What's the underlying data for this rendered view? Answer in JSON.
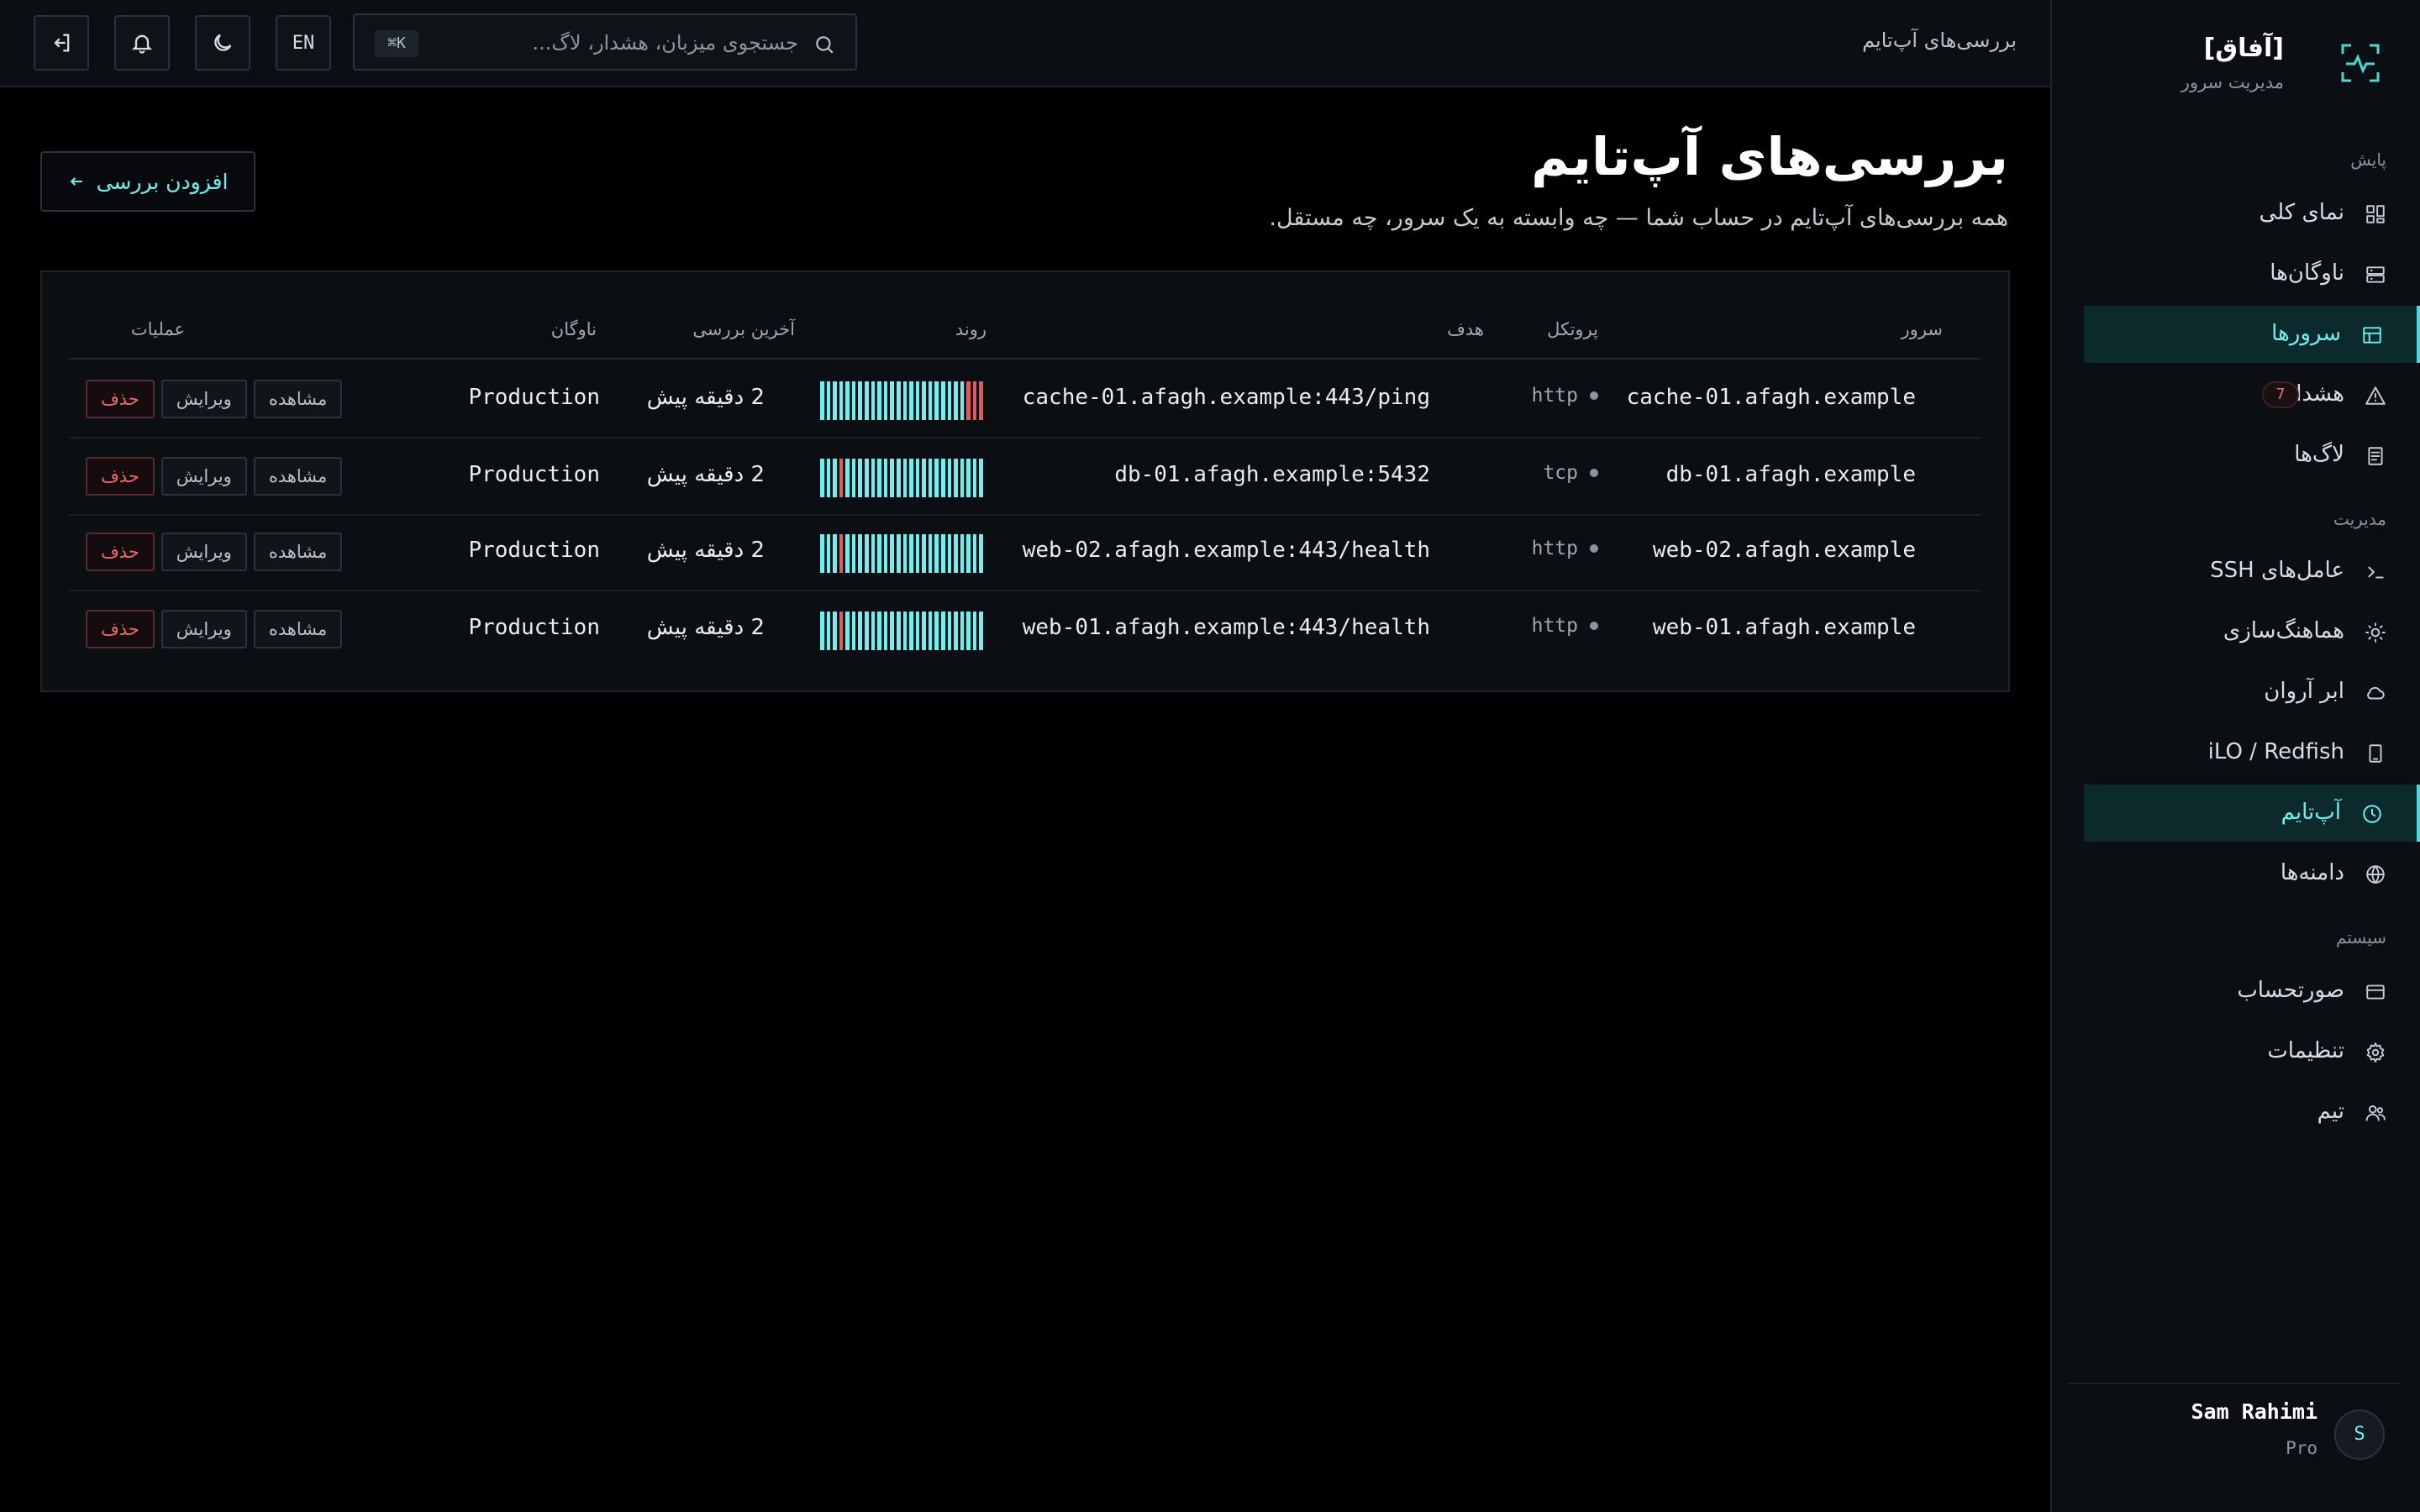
{
  "brand": {
    "name": "[آفاق]",
    "subtitle": "مدیریت سرور"
  },
  "header": {
    "title": "بررسی‌های آپ‌تایم",
    "search_placeholder": "جستجوی میزبان، هشدار، لاگ...",
    "search_shortcut": "⌘K",
    "language": "EN"
  },
  "sidebar": {
    "sections": [
      {
        "label": "پایش",
        "items": [
          {
            "label": "نمای کلی",
            "icon": "grid-icon"
          },
          {
            "label": "ناوگان‌ها",
            "icon": "server-stack-icon"
          },
          {
            "label": "سرورها",
            "icon": "table-icon",
            "active": true
          },
          {
            "label": "هشدارها",
            "icon": "warning-icon",
            "badge": "7"
          },
          {
            "label": "لاگ‌ها",
            "icon": "document-icon"
          }
        ]
      },
      {
        "label": "مدیریت",
        "items": [
          {
            "label": "عامل‌های SSH",
            "icon": "terminal-icon"
          },
          {
            "label": "هماهنگ‌سازی",
            "icon": "sun-icon"
          },
          {
            "label": "ابر آروان",
            "icon": "cloud-icon"
          },
          {
            "label": "iLO / Redfish",
            "icon": "device-icon"
          },
          {
            "label": "آپ‌تایم",
            "icon": "clock-icon",
            "active": true
          },
          {
            "label": "دامنه‌ها",
            "icon": "globe-icon"
          }
        ]
      },
      {
        "label": "سیستم",
        "items": [
          {
            "label": "صورتحساب",
            "icon": "card-icon"
          },
          {
            "label": "تنظیمات",
            "icon": "gear-icon"
          },
          {
            "label": "تیم",
            "icon": "users-icon"
          }
        ]
      }
    ],
    "user": {
      "initial": "S",
      "name": "Sam Rahimi",
      "plan": "Pro"
    }
  },
  "main": {
    "title": "بررسی‌های آپ‌تایم",
    "subtitle": "همه بررسی‌های آپ‌تایم در حساب شما — چه وابسته به یک سرور، چه مستقل.",
    "add_button": "افزودن بررسی",
    "columns": {
      "server": "سرور",
      "protocol": "پروتکل",
      "target": "هدف",
      "trend": "روند",
      "last_check": "آخرین بررسی",
      "fleet": "ناوگان",
      "actions": "عملیات"
    },
    "action_labels": {
      "view": "مشاهده",
      "edit": "ویرایش",
      "delete": "حذف"
    },
    "rows": [
      {
        "server": "cache-01.afagh.example",
        "protocol": "http",
        "target": "cache-01.afagh.example:443/ping",
        "last_check": "2 دقیقه پیش",
        "fleet": "Production",
        "trend": [
          1,
          1,
          1,
          1,
          1,
          1,
          1,
          1,
          1,
          1,
          1,
          1,
          1,
          1,
          1,
          1,
          1,
          1,
          1,
          1,
          1,
          1,
          1,
          0,
          0,
          0
        ]
      },
      {
        "server": "db-01.afagh.example",
        "protocol": "tcp",
        "target": "db-01.afagh.example:5432",
        "last_check": "2 دقیقه پیش",
        "fleet": "Production",
        "trend": [
          1,
          1,
          1,
          0,
          1,
          1,
          1,
          1,
          1,
          1,
          1,
          1,
          1,
          1,
          1,
          1,
          1,
          1,
          1,
          1,
          1,
          1,
          1,
          1,
          1,
          1
        ]
      },
      {
        "server": "web-02.afagh.example",
        "protocol": "http",
        "target": "web-02.afagh.example:443/health",
        "last_check": "2 دقیقه پیش",
        "fleet": "Production",
        "trend": [
          1,
          1,
          1,
          0,
          1,
          1,
          1,
          1,
          1,
          1,
          1,
          1,
          1,
          1,
          1,
          1,
          1,
          1,
          1,
          1,
          1,
          1,
          1,
          1,
          1,
          1
        ]
      },
      {
        "server": "web-01.afagh.example",
        "protocol": "http",
        "target": "web-01.afagh.example:443/health",
        "last_check": "2 دقیقه پیش",
        "fleet": "Production",
        "trend": [
          1,
          1,
          1,
          0,
          1,
          1,
          1,
          1,
          1,
          1,
          1,
          1,
          1,
          1,
          1,
          1,
          1,
          1,
          1,
          1,
          1,
          1,
          1,
          1,
          1,
          1
        ]
      }
    ]
  },
  "colors": {
    "accent": "#6ff0ef",
    "danger": "#e25b5b",
    "background": "#000000",
    "panel": "#0b0e12"
  }
}
